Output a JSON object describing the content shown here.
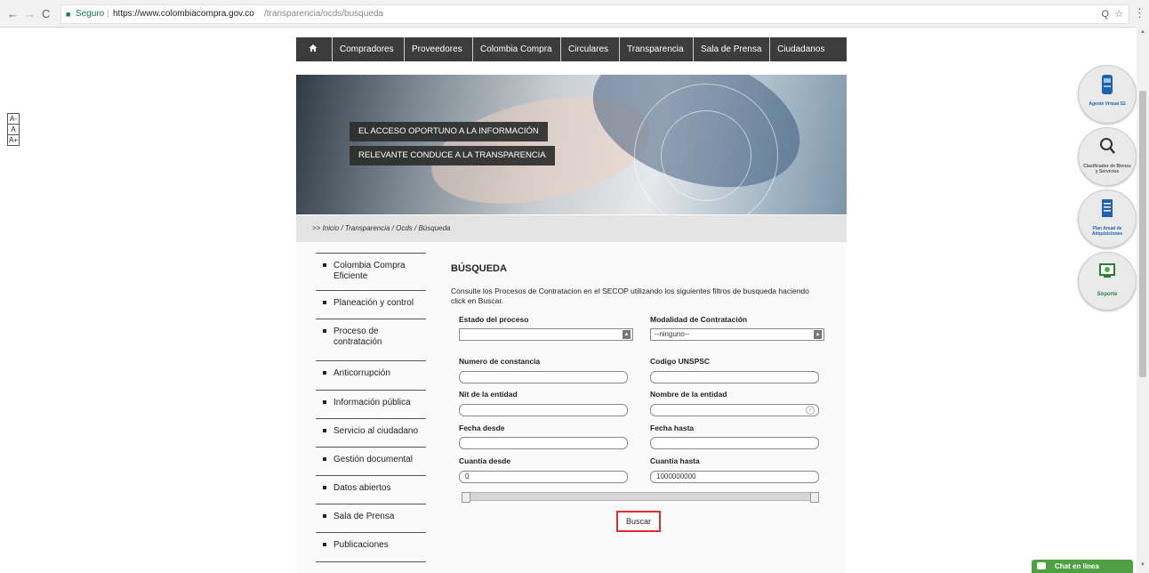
{
  "browser": {
    "back": "←",
    "forward": "→",
    "reload": "C",
    "secure_label": "Seguro",
    "url_host": "https://www.colombiacompra.gov.co",
    "url_path": "/transparencia/ocds/busqueda",
    "zoom_icon": "Q",
    "star_icon": "☆",
    "menu_icon": "⋮"
  },
  "font_controls": [
    "A-",
    "A",
    "A+"
  ],
  "nav": {
    "home_icon": "home-icon",
    "items": [
      "Compradores",
      "Proveedores",
      "Colombia Compra",
      "Circulares",
      "Transparencia",
      "Sala de Prensa",
      "Ciudadanos"
    ]
  },
  "banner": {
    "line1": "EL ACCESO OPORTUNO A LA INFORMACIÓN",
    "line2": "RELEVANTE CONDUCE A LA TRANSPARENCIA"
  },
  "breadcrumb": ">> Inicio / Transparencia / Ocds / Búsqueda",
  "sidebar": {
    "items": [
      "Colombia Compra Eficiente",
      "Planeación y control",
      "Proceso de contratación",
      "Anticorrupción",
      "Información pública",
      "Servicio al ciudadano",
      "Gestión documental",
      "Datos abiertos",
      "Sala de Prensa",
      "Publicaciones"
    ]
  },
  "search": {
    "title": "BÚSQUEDA",
    "intro": "Consulte los Procesos de Contratacion en el SECOP utilizando los siguientes filtros de busqueda haciendo click en Buscar.",
    "estado_label": "Estado del proceso",
    "estado_value": "",
    "modalidad_label": "Modalidad de Contratación",
    "modalidad_value": "--ninguno--",
    "constancia_label": "Numero de constancia",
    "unspsc_label": "Codigo UNSPSC",
    "nit_label": "Nit de la entidad",
    "nombre_label": "Nombre de la entidad",
    "fecha_desde_label": "Fecha desde",
    "fecha_hasta_label": "Fecha hasta",
    "cuantia_desde_label": "Cuantía desde",
    "cuantia_desde_value": "0",
    "cuantia_hasta_label": "Cuantía hasta",
    "cuantia_hasta_value": "1000000000",
    "buscar_label": "Buscar"
  },
  "widgets": {
    "agente": "Agente Virtual S2",
    "clasificador": "Clasificador de Bienes y Servicios",
    "plan": "Plan Anual de Adquisiciones",
    "soporte": "Soporte"
  },
  "chat": "Chat en línea",
  "colors": {
    "nav_bg": "#3c3c3c",
    "highlight": "#d9302f",
    "chat_green": "#4fa043",
    "widget_blue": "#1f62b0"
  }
}
